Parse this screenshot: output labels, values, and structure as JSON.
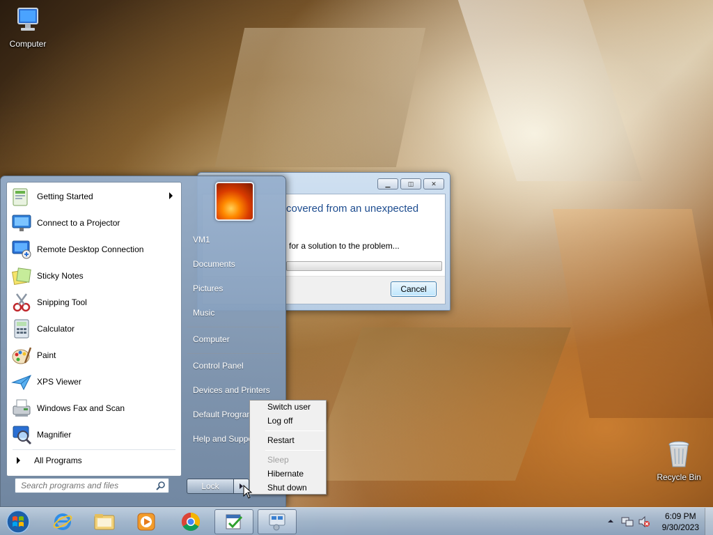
{
  "desktop": {
    "icons": [
      {
        "label": "Computer",
        "icon": "computer-icon"
      },
      {
        "label": "Recycle Bin",
        "icon": "recycle-bin-icon"
      }
    ]
  },
  "dialog": {
    "heading": "covered from an unexpected",
    "message": "for a solution to the problem...",
    "cancel_label": "Cancel",
    "title_buttons": [
      "minimize",
      "maximize",
      "close"
    ]
  },
  "start_menu": {
    "programs": [
      {
        "label": "Getting Started",
        "icon": "getting-started-icon",
        "has_submenu": true
      },
      {
        "label": "Connect to a Projector",
        "icon": "projector-icon"
      },
      {
        "label": "Remote Desktop Connection",
        "icon": "remote-desktop-icon"
      },
      {
        "label": "Sticky Notes",
        "icon": "sticky-notes-icon"
      },
      {
        "label": "Snipping Tool",
        "icon": "snipping-tool-icon"
      },
      {
        "label": "Calculator",
        "icon": "calculator-icon"
      },
      {
        "label": "Paint",
        "icon": "paint-icon"
      },
      {
        "label": "XPS Viewer",
        "icon": "xps-viewer-icon"
      },
      {
        "label": "Windows Fax and Scan",
        "icon": "fax-scan-icon"
      },
      {
        "label": "Magnifier",
        "icon": "magnifier-icon"
      }
    ],
    "all_programs": "All Programs",
    "search_placeholder": "Search programs and files",
    "user_name": "VM1",
    "right_links": [
      "VM1",
      "Documents",
      "Pictures",
      "Music",
      "Computer",
      "Control Panel",
      "Devices and Printers",
      "Default Programs",
      "Help and Support"
    ],
    "lock_label": "Lock"
  },
  "power_menu": {
    "items": [
      {
        "label": "Switch user",
        "enabled": true
      },
      {
        "label": "Log off",
        "enabled": true
      },
      {
        "label": "Restart",
        "enabled": true
      },
      {
        "label": "Sleep",
        "enabled": false
      },
      {
        "label": "Hibernate",
        "enabled": true
      },
      {
        "label": "Shut down",
        "enabled": true
      }
    ]
  },
  "taskbar": {
    "buttons": [
      "internet-explorer-icon",
      "windows-explorer-icon",
      "media-player-icon",
      "chrome-icon",
      "task-scheduler-icon",
      "system-tool-icon"
    ],
    "clock": {
      "time": "6:09 PM",
      "date": "9/30/2023"
    }
  }
}
